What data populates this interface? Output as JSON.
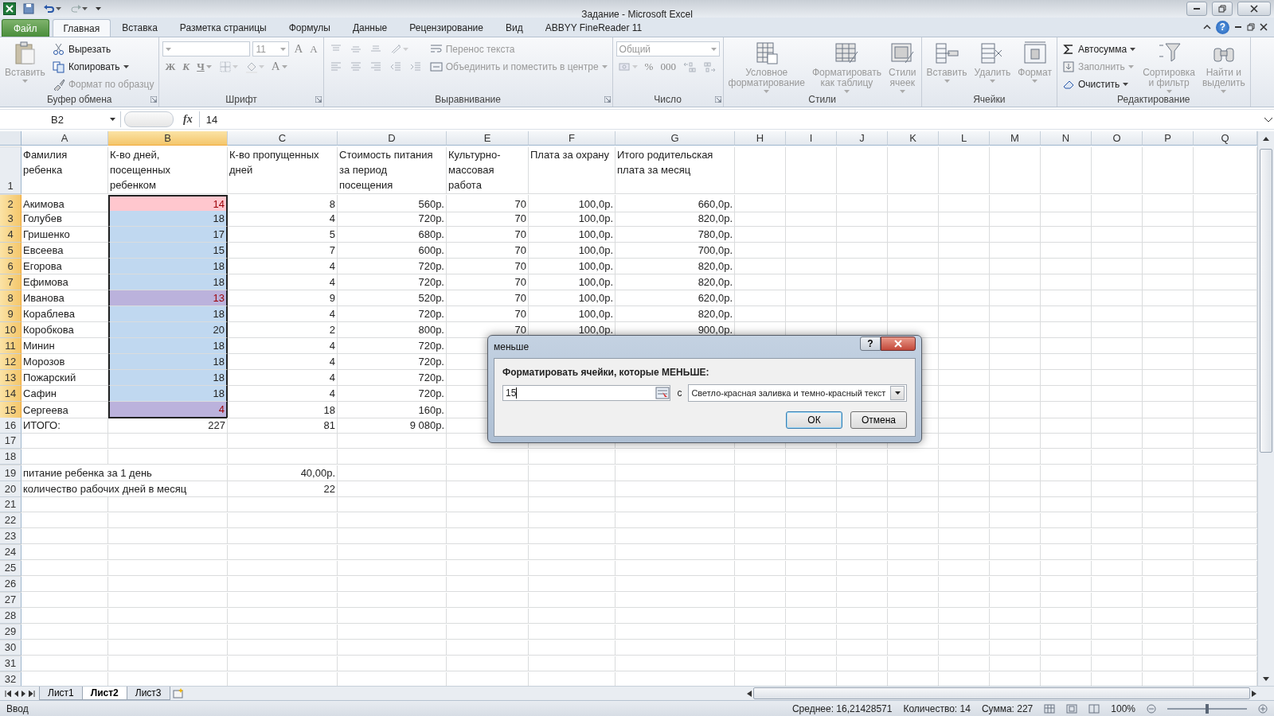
{
  "window": {
    "title": "Задание - Microsoft Excel",
    "help_label": "?"
  },
  "ribbon_tabs": [
    {
      "label": "Файл",
      "kind": "file",
      "selected": false
    },
    {
      "label": "Главная",
      "kind": "tab",
      "selected": true
    },
    {
      "label": "Вставка",
      "kind": "tab",
      "selected": false
    },
    {
      "label": "Разметка страницы",
      "kind": "tab",
      "selected": false
    },
    {
      "label": "Формулы",
      "kind": "tab",
      "selected": false
    },
    {
      "label": "Данные",
      "kind": "tab",
      "selected": false
    },
    {
      "label": "Рецензирование",
      "kind": "tab",
      "selected": false
    },
    {
      "label": "Вид",
      "kind": "tab",
      "selected": false
    },
    {
      "label": "ABBYY FineReader 11",
      "kind": "tab",
      "selected": false
    }
  ],
  "ribbon_groups": [
    {
      "name": "Буфер обмена",
      "launcher": true,
      "columns": [
        [
          [
            {
              "kind": "large",
              "label": "Вставить",
              "disabled": true,
              "dropdown": true
            }
          ]
        ],
        [
          [
            {
              "kind": "small",
              "label": "Вырезать",
              "disabled": false,
              "dropdown": false
            }
          ],
          [
            {
              "kind": "small",
              "label": "Копировать",
              "disabled": false,
              "dropdown": true
            }
          ],
          [
            {
              "kind": "small",
              "label": "Формат по образцу",
              "disabled": true,
              "dropdown": false
            }
          ]
        ]
      ]
    },
    {
      "name": "Шрифт",
      "launcher": true,
      "columns": [
        [
          [
            {
              "kind": "combo",
              "disabled": true,
              "dropdown": true
            },
            {
              "kind": "combo",
              "value": "11",
              "disabled": true,
              "dropdown": true
            },
            {
              "kind": "glyph",
              "label": "A",
              "disabled": true,
              "dropdown": false
            },
            {
              "kind": "glyph",
              "label": "A",
              "disabled": true,
              "dropdown": false
            }
          ],
          [
            {
              "kind": "glyph",
              "label": "Ж",
              "disabled": true,
              "dropdown": false
            },
            {
              "kind": "glyph",
              "label": "К",
              "disabled": true,
              "dropdown": false
            },
            {
              "kind": "glyph",
              "label": "Ч",
              "disabled": true,
              "dropdown": true
            },
            {
              "kind": "icon",
              "disabled": true,
              "dropdown": true
            },
            {
              "kind": "icon",
              "disabled": true,
              "dropdown": true
            },
            {
              "kind": "glyph",
              "label": "A",
              "disabled": true,
              "dropdown": true
            }
          ]
        ]
      ]
    },
    {
      "name": "Выравнивание",
      "launcher": true,
      "columns": [
        [
          [
            {
              "kind": "icon",
              "disabled": true,
              "dropdown": false
            },
            {
              "kind": "icon",
              "disabled": true,
              "dropdown": false
            },
            {
              "kind": "icon",
              "disabled": true,
              "dropdown": false
            },
            {
              "kind": "icon",
              "disabled": true,
              "dropdown": true
            }
          ],
          [
            {
              "kind": "icon",
              "disabled": true,
              "dropdown": false
            },
            {
              "kind": "icon",
              "disabled": true,
              "dropdown": false
            },
            {
              "kind": "icon",
              "disabled": true,
              "dropdown": false
            },
            {
              "kind": "icon",
              "disabled": true,
              "dropdown": false
            },
            {
              "kind": "icon",
              "disabled": true,
              "dropdown": false
            }
          ]
        ],
        [
          [
            {
              "kind": "small",
              "label": "Перенос текста",
              "disabled": true,
              "dropdown": false
            }
          ],
          [
            {
              "kind": "small",
              "label": "Объединить и поместить в центре",
              "disabled": true,
              "dropdown": true
            }
          ]
        ]
      ]
    },
    {
      "name": "Число",
      "launcher": true,
      "columns": [
        [
          [
            {
              "kind": "combo",
              "value": "Общий",
              "disabled": true,
              "dropdown": true
            }
          ],
          [
            {
              "kind": "icon",
              "disabled": true,
              "dropdown": true
            },
            {
              "kind": "glyph",
              "label": "%",
              "disabled": true,
              "dropdown": false
            },
            {
              "kind": "glyph",
              "label": "000",
              "disabled": true,
              "dropdown": false
            },
            {
              "kind": "icon",
              "disabled": true,
              "dropdown": false
            },
            {
              "kind": "icon",
              "disabled": true,
              "dropdown": false
            }
          ]
        ]
      ]
    },
    {
      "name": "Стили",
      "launcher": false,
      "columns": [
        [
          [
            {
              "kind": "large",
              "label": "Условное\nформатирование",
              "disabled": true,
              "dropdown": true
            }
          ]
        ],
        [
          [
            {
              "kind": "large",
              "label": "Форматировать\nкак таблицу",
              "disabled": true,
              "dropdown": true
            }
          ]
        ],
        [
          [
            {
              "kind": "large",
              "label": "Стили\nячеек",
              "disabled": true,
              "dropdown": true
            }
          ]
        ]
      ]
    },
    {
      "name": "Ячейки",
      "launcher": false,
      "columns": [
        [
          [
            {
              "kind": "large",
              "label": "Вставить",
              "disabled": true,
              "dropdown": true
            }
          ]
        ],
        [
          [
            {
              "kind": "large",
              "label": "Удалить",
              "disabled": true,
              "dropdown": true
            }
          ]
        ],
        [
          [
            {
              "kind": "large",
              "label": "Формат",
              "disabled": true,
              "dropdown": true
            }
          ]
        ]
      ]
    },
    {
      "name": "Редактирование",
      "launcher": false,
      "columns": [
        [
          [
            {
              "kind": "small",
              "label": "Автосумма",
              "disabled": false,
              "dropdown": true
            }
          ],
          [
            {
              "kind": "small",
              "label": "Заполнить",
              "disabled": true,
              "dropdown": true
            }
          ],
          [
            {
              "kind": "small",
              "label": "Очистить",
              "disabled": false,
              "dropdown": true
            }
          ]
        ],
        [
          [
            {
              "kind": "large",
              "label": "Сортировка\nи фильтр",
              "disabled": true,
              "dropdown": true
            }
          ]
        ],
        [
          [
            {
              "kind": "large",
              "label": "Найти и\nвыделить",
              "disabled": true,
              "dropdown": true
            }
          ]
        ]
      ]
    }
  ],
  "formula_bar": {
    "name_box": "B2",
    "function_label": "fx",
    "value": "14"
  },
  "columns": [
    {
      "label": "A",
      "selected": false
    },
    {
      "label": "B",
      "selected": true
    },
    {
      "label": "C",
      "selected": false
    },
    {
      "label": "D",
      "selected": false
    },
    {
      "label": "E",
      "selected": false
    },
    {
      "label": "F",
      "selected": false
    },
    {
      "label": "G",
      "selected": false
    },
    {
      "label": "H",
      "selected": false
    },
    {
      "label": "I",
      "selected": false
    },
    {
      "label": "J",
      "selected": false
    },
    {
      "label": "K",
      "selected": false
    },
    {
      "label": "L",
      "selected": false
    },
    {
      "label": "M",
      "selected": false
    },
    {
      "label": "N",
      "selected": false
    },
    {
      "label": "O",
      "selected": false
    },
    {
      "label": "P",
      "selected": false
    },
    {
      "label": "Q",
      "selected": false
    }
  ],
  "rows": [
    {
      "label": "1",
      "selected": false,
      "cells": {
        "A": {
          "text": "Фамилия\nребенка"
        },
        "B": {
          "text": "К-во дней,\nпосещенных\nребенком"
        },
        "C": {
          "text": "К-во пропущенных\nдней"
        },
        "D": {
          "text": "Стоимость питания\nза период\nпосещения"
        },
        "E": {
          "text": "Культурно-\nмассовая\nработа"
        },
        "F": {
          "text": "Плата за охрану"
        },
        "G": {
          "text": "Итого родительская\nплата за месяц"
        }
      }
    },
    {
      "label": "2",
      "selected": true,
      "cells": {
        "A": {
          "text": "Акимова"
        },
        "B": {
          "text": "14",
          "matched": true,
          "selected": true,
          "active": true
        },
        "C": {
          "text": "8"
        },
        "D": {
          "text": "560р."
        },
        "E": {
          "text": "70"
        },
        "F": {
          "text": "100,0р."
        },
        "G": {
          "text": "660,0р."
        }
      }
    },
    {
      "label": "3",
      "selected": true,
      "cells": {
        "A": {
          "text": "Голубев"
        },
        "B": {
          "text": "18",
          "matched": false,
          "selected": true,
          "active": false
        },
        "C": {
          "text": "4"
        },
        "D": {
          "text": "720р."
        },
        "E": {
          "text": "70"
        },
        "F": {
          "text": "100,0р."
        },
        "G": {
          "text": "820,0р."
        }
      }
    },
    {
      "label": "4",
      "selected": true,
      "cells": {
        "A": {
          "text": "Гришенко"
        },
        "B": {
          "text": "17",
          "matched": false,
          "selected": true,
          "active": false
        },
        "C": {
          "text": "5"
        },
        "D": {
          "text": "680р."
        },
        "E": {
          "text": "70"
        },
        "F": {
          "text": "100,0р."
        },
        "G": {
          "text": "780,0р."
        }
      }
    },
    {
      "label": "5",
      "selected": true,
      "cells": {
        "A": {
          "text": "Евсеева"
        },
        "B": {
          "text": "15",
          "matched": false,
          "selected": true,
          "active": false
        },
        "C": {
          "text": "7"
        },
        "D": {
          "text": "600р."
        },
        "E": {
          "text": "70"
        },
        "F": {
          "text": "100,0р."
        },
        "G": {
          "text": "700,0р."
        }
      }
    },
    {
      "label": "6",
      "selected": true,
      "cells": {
        "A": {
          "text": "Егорова"
        },
        "B": {
          "text": "18",
          "matched": false,
          "selected": true,
          "active": false
        },
        "C": {
          "text": "4"
        },
        "D": {
          "text": "720р."
        },
        "E": {
          "text": "70"
        },
        "F": {
          "text": "100,0р."
        },
        "G": {
          "text": "820,0р."
        }
      }
    },
    {
      "label": "7",
      "selected": true,
      "cells": {
        "A": {
          "text": "Ефимова"
        },
        "B": {
          "text": "18",
          "matched": false,
          "selected": true,
          "active": false
        },
        "C": {
          "text": "4"
        },
        "D": {
          "text": "720р."
        },
        "E": {
          "text": "70"
        },
        "F": {
          "text": "100,0р."
        },
        "G": {
          "text": "820,0р."
        }
      }
    },
    {
      "label": "8",
      "selected": true,
      "cells": {
        "A": {
          "text": "Иванова"
        },
        "B": {
          "text": "13",
          "matched": true,
          "selected": true,
          "active": false
        },
        "C": {
          "text": "9"
        },
        "D": {
          "text": "520р."
        },
        "E": {
          "text": "70"
        },
        "F": {
          "text": "100,0р."
        },
        "G": {
          "text": "620,0р."
        }
      }
    },
    {
      "label": "9",
      "selected": true,
      "cells": {
        "A": {
          "text": "Кораблева"
        },
        "B": {
          "text": "18",
          "matched": false,
          "selected": true,
          "active": false
        },
        "C": {
          "text": "4"
        },
        "D": {
          "text": "720р."
        },
        "E": {
          "text": "70"
        },
        "F": {
          "text": "100,0р."
        },
        "G": {
          "text": "820,0р."
        }
      }
    },
    {
      "label": "10",
      "selected": true,
      "cells": {
        "A": {
          "text": "Коробкова"
        },
        "B": {
          "text": "20",
          "matched": false,
          "selected": true,
          "active": false
        },
        "C": {
          "text": "2"
        },
        "D": {
          "text": "800р."
        },
        "E": {
          "text": "70"
        },
        "F": {
          "text": "100,0р."
        },
        "G": {
          "text": "900,0р."
        }
      }
    },
    {
      "label": "11",
      "selected": true,
      "cells": {
        "A": {
          "text": "Минин"
        },
        "B": {
          "text": "18",
          "matched": false,
          "selected": true,
          "active": false
        },
        "C": {
          "text": "4"
        },
        "D": {
          "text": "720р."
        }
      }
    },
    {
      "label": "12",
      "selected": true,
      "cells": {
        "A": {
          "text": "Морозов"
        },
        "B": {
          "text": "18",
          "matched": false,
          "selected": true,
          "active": false
        },
        "C": {
          "text": "4"
        },
        "D": {
          "text": "720р."
        }
      }
    },
    {
      "label": "13",
      "selected": true,
      "cells": {
        "A": {
          "text": "Пожарский"
        },
        "B": {
          "text": "18",
          "matched": false,
          "selected": true,
          "active": false
        },
        "C": {
          "text": "4"
        },
        "D": {
          "text": "720р."
        }
      }
    },
    {
      "label": "14",
      "selected": true,
      "cells": {
        "A": {
          "text": "Сафин"
        },
        "B": {
          "text": "18",
          "matched": false,
          "selected": true,
          "active": false
        },
        "C": {
          "text": "4"
        },
        "D": {
          "text": "720р."
        }
      }
    },
    {
      "label": "15",
      "selected": true,
      "cells": {
        "A": {
          "text": "Сергеева"
        },
        "B": {
          "text": "4",
          "matched": true,
          "selected": true,
          "active": false
        },
        "C": {
          "text": "18"
        },
        "D": {
          "text": "160р."
        }
      }
    },
    {
      "label": "16",
      "selected": false,
      "cells": {
        "A": {
          "text": "ИТОГО:"
        },
        "B": {
          "text": "227"
        },
        "C": {
          "text": "81"
        },
        "D": {
          "text": "9 080р."
        }
      }
    },
    {
      "label": "17",
      "selected": false
    },
    {
      "label": "18",
      "selected": false
    },
    {
      "label": "19",
      "selected": false,
      "cells": {
        "A": {
          "text": "питание ребенка за 1 день"
        },
        "C": {
          "text": "40,00р."
        }
      }
    },
    {
      "label": "20",
      "selected": false,
      "cells": {
        "A": {
          "text": "количество рабочих дней в месяц"
        },
        "C": {
          "text": "22"
        }
      }
    },
    {
      "label": "21",
      "selected": false
    },
    {
      "label": "22",
      "selected": false
    },
    {
      "label": "23",
      "selected": false
    },
    {
      "label": "24",
      "selected": false
    },
    {
      "label": "25",
      "selected": false
    },
    {
      "label": "26",
      "selected": false
    },
    {
      "label": "27",
      "selected": false
    },
    {
      "label": "28",
      "selected": false
    },
    {
      "label": "29",
      "selected": false
    },
    {
      "label": "30",
      "selected": false
    },
    {
      "label": "31",
      "selected": false
    },
    {
      "label": "32",
      "selected": false
    }
  ],
  "sheet_tabs": [
    {
      "label": "Лист1",
      "selected": false
    },
    {
      "label": "Лист2",
      "selected": true
    },
    {
      "label": "Лист3",
      "selected": false
    }
  ],
  "status_bar": {
    "mode": "Ввод",
    "stats": [
      "Среднее: 16,21428571",
      "Количество: 14",
      "Сумма: 227"
    ],
    "zoom": {
      "label": "100%",
      "level": 0.5
    }
  },
  "dialog": {
    "title": "меньше",
    "help_label": "?",
    "prompt": "Форматировать ячейки, которые МЕНЬШЕ:",
    "value": "15",
    "connector": "с",
    "format": "Светло-красная заливка и темно-красный текст",
    "buttons": [
      {
        "label": "ОК",
        "default": true
      },
      {
        "label": "Отмена",
        "default": false
      }
    ]
  }
}
